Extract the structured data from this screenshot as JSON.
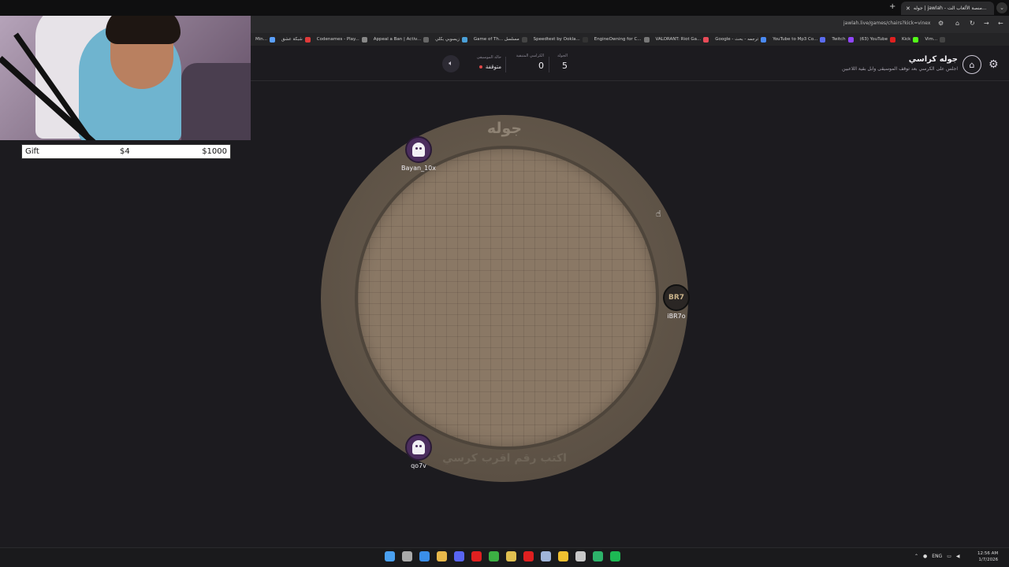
{
  "browser": {
    "tab_title": "جوله | jawlah - منصة الألعاب الت...",
    "url": "jawlah.live/games/chairs?kick=vinex",
    "bookmarks": [
      {
        "label": "Min...",
        "color": "#5aa0ff"
      },
      {
        "label": "شبكة عشق",
        "color": "#e03a3a"
      },
      {
        "label": "Codenames - Play...",
        "color": "#888888"
      },
      {
        "label": "Appeal a Ban | Activ...",
        "color": "#666666"
      },
      {
        "label": "زيسوبي بكلي",
        "color": "#4aa0d8"
      },
      {
        "label": "Game of Th... مسلسل",
        "color": "#444444"
      },
      {
        "label": "Speedtest by Ookla...",
        "color": "#333333"
      },
      {
        "label": "EngineOwning for C...",
        "color": "#777777"
      },
      {
        "label": "VALORANT: Riot Ga...",
        "color": "#e84b58"
      },
      {
        "label": "Google - ترجمه - بحث",
        "color": "#4a8af4"
      },
      {
        "label": "YouTube to Mp3 Co...",
        "color": "#5a6cf0"
      },
      {
        "label": "Twitch",
        "color": "#9146ff"
      },
      {
        "label": "(63) YouTube",
        "color": "#e02020"
      },
      {
        "label": "Kick",
        "color": "#53fc18"
      },
      {
        "label": "Vim...",
        "color": "#444444"
      }
    ]
  },
  "header": {
    "title": "جوله كراسي",
    "subtitle": "اجلس على الكرسي بعد توقف الموسيقى وابل بقية اللاعبين",
    "stats": {
      "round_label": "الجولة",
      "round_value": "5",
      "chairs_label": "الكراسي المتبقية",
      "chairs_value": "0",
      "music_label": "حالة الموسيقى",
      "music_value": "متوقفة"
    }
  },
  "board": {
    "logo": "جوله",
    "prompt": "اكتب رقم اقرب كرسي"
  },
  "players": [
    {
      "name": "Bayan_10x",
      "avatar": "ghost-icon"
    },
    {
      "name": "iBR7o",
      "avatar": "brand-icon",
      "mark": "BR7"
    },
    {
      "name": "qo7v",
      "avatar": "ghost-icon"
    }
  ],
  "overlay": {
    "gift_label": "Gift",
    "gift_amount": "$4",
    "gift_goal": "$1000"
  },
  "taskbar": {
    "lang": "ENG",
    "time": "12:56 AM",
    "date": "1/7/2026",
    "icon_colors": [
      "#4aa0f0",
      "#aaaaaa",
      "#3a8ee8",
      "#e8b84a",
      "#5865f2",
      "#e02020",
      "#3cb043",
      "#e0c050",
      "#e02020",
      "#9fb4d8",
      "#f0c030",
      "#c8c8c8",
      "#2db36a",
      "#1db954"
    ]
  }
}
